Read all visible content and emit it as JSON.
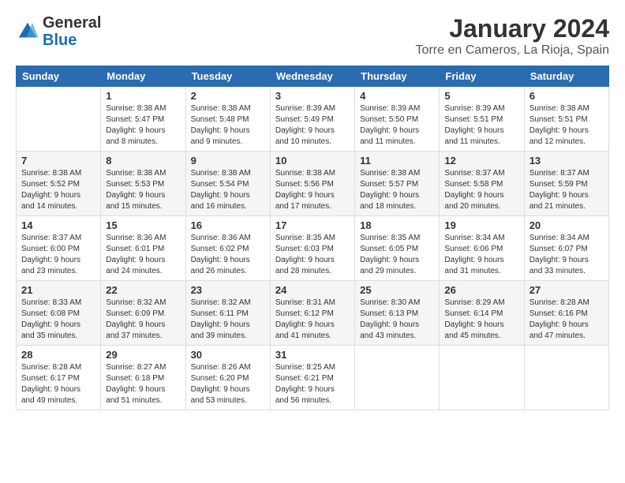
{
  "header": {
    "logo_general": "General",
    "logo_blue": "Blue",
    "title": "January 2024",
    "subtitle": "Torre en Cameros, La Rioja, Spain"
  },
  "calendar": {
    "days_of_week": [
      "Sunday",
      "Monday",
      "Tuesday",
      "Wednesday",
      "Thursday",
      "Friday",
      "Saturday"
    ],
    "weeks": [
      [
        {
          "day": "",
          "info": ""
        },
        {
          "day": "1",
          "info": "Sunrise: 8:38 AM\nSunset: 5:47 PM\nDaylight: 9 hours\nand 8 minutes."
        },
        {
          "day": "2",
          "info": "Sunrise: 8:38 AM\nSunset: 5:48 PM\nDaylight: 9 hours\nand 9 minutes."
        },
        {
          "day": "3",
          "info": "Sunrise: 8:39 AM\nSunset: 5:49 PM\nDaylight: 9 hours\nand 10 minutes."
        },
        {
          "day": "4",
          "info": "Sunrise: 8:39 AM\nSunset: 5:50 PM\nDaylight: 9 hours\nand 11 minutes."
        },
        {
          "day": "5",
          "info": "Sunrise: 8:39 AM\nSunset: 5:51 PM\nDaylight: 9 hours\nand 11 minutes."
        },
        {
          "day": "6",
          "info": "Sunrise: 8:38 AM\nSunset: 5:51 PM\nDaylight: 9 hours\nand 12 minutes."
        }
      ],
      [
        {
          "day": "7",
          "info": "Sunrise: 8:38 AM\nSunset: 5:52 PM\nDaylight: 9 hours\nand 14 minutes."
        },
        {
          "day": "8",
          "info": "Sunrise: 8:38 AM\nSunset: 5:53 PM\nDaylight: 9 hours\nand 15 minutes."
        },
        {
          "day": "9",
          "info": "Sunrise: 8:38 AM\nSunset: 5:54 PM\nDaylight: 9 hours\nand 16 minutes."
        },
        {
          "day": "10",
          "info": "Sunrise: 8:38 AM\nSunset: 5:56 PM\nDaylight: 9 hours\nand 17 minutes."
        },
        {
          "day": "11",
          "info": "Sunrise: 8:38 AM\nSunset: 5:57 PM\nDaylight: 9 hours\nand 18 minutes."
        },
        {
          "day": "12",
          "info": "Sunrise: 8:37 AM\nSunset: 5:58 PM\nDaylight: 9 hours\nand 20 minutes."
        },
        {
          "day": "13",
          "info": "Sunrise: 8:37 AM\nSunset: 5:59 PM\nDaylight: 9 hours\nand 21 minutes."
        }
      ],
      [
        {
          "day": "14",
          "info": "Sunrise: 8:37 AM\nSunset: 6:00 PM\nDaylight: 9 hours\nand 23 minutes."
        },
        {
          "day": "15",
          "info": "Sunrise: 8:36 AM\nSunset: 6:01 PM\nDaylight: 9 hours\nand 24 minutes."
        },
        {
          "day": "16",
          "info": "Sunrise: 8:36 AM\nSunset: 6:02 PM\nDaylight: 9 hours\nand 26 minutes."
        },
        {
          "day": "17",
          "info": "Sunrise: 8:35 AM\nSunset: 6:03 PM\nDaylight: 9 hours\nand 28 minutes."
        },
        {
          "day": "18",
          "info": "Sunrise: 8:35 AM\nSunset: 6:05 PM\nDaylight: 9 hours\nand 29 minutes."
        },
        {
          "day": "19",
          "info": "Sunrise: 8:34 AM\nSunset: 6:06 PM\nDaylight: 9 hours\nand 31 minutes."
        },
        {
          "day": "20",
          "info": "Sunrise: 8:34 AM\nSunset: 6:07 PM\nDaylight: 9 hours\nand 33 minutes."
        }
      ],
      [
        {
          "day": "21",
          "info": "Sunrise: 8:33 AM\nSunset: 6:08 PM\nDaylight: 9 hours\nand 35 minutes."
        },
        {
          "day": "22",
          "info": "Sunrise: 8:32 AM\nSunset: 6:09 PM\nDaylight: 9 hours\nand 37 minutes."
        },
        {
          "day": "23",
          "info": "Sunrise: 8:32 AM\nSunset: 6:11 PM\nDaylight: 9 hours\nand 39 minutes."
        },
        {
          "day": "24",
          "info": "Sunrise: 8:31 AM\nSunset: 6:12 PM\nDaylight: 9 hours\nand 41 minutes."
        },
        {
          "day": "25",
          "info": "Sunrise: 8:30 AM\nSunset: 6:13 PM\nDaylight: 9 hours\nand 43 minutes."
        },
        {
          "day": "26",
          "info": "Sunrise: 8:29 AM\nSunset: 6:14 PM\nDaylight: 9 hours\nand 45 minutes."
        },
        {
          "day": "27",
          "info": "Sunrise: 8:28 AM\nSunset: 6:16 PM\nDaylight: 9 hours\nand 47 minutes."
        }
      ],
      [
        {
          "day": "28",
          "info": "Sunrise: 8:28 AM\nSunset: 6:17 PM\nDaylight: 9 hours\nand 49 minutes."
        },
        {
          "day": "29",
          "info": "Sunrise: 8:27 AM\nSunset: 6:18 PM\nDaylight: 9 hours\nand 51 minutes."
        },
        {
          "day": "30",
          "info": "Sunrise: 8:26 AM\nSunset: 6:20 PM\nDaylight: 9 hours\nand 53 minutes."
        },
        {
          "day": "31",
          "info": "Sunrise: 8:25 AM\nSunset: 6:21 PM\nDaylight: 9 hours\nand 56 minutes."
        },
        {
          "day": "",
          "info": ""
        },
        {
          "day": "",
          "info": ""
        },
        {
          "day": "",
          "info": ""
        }
      ]
    ]
  }
}
